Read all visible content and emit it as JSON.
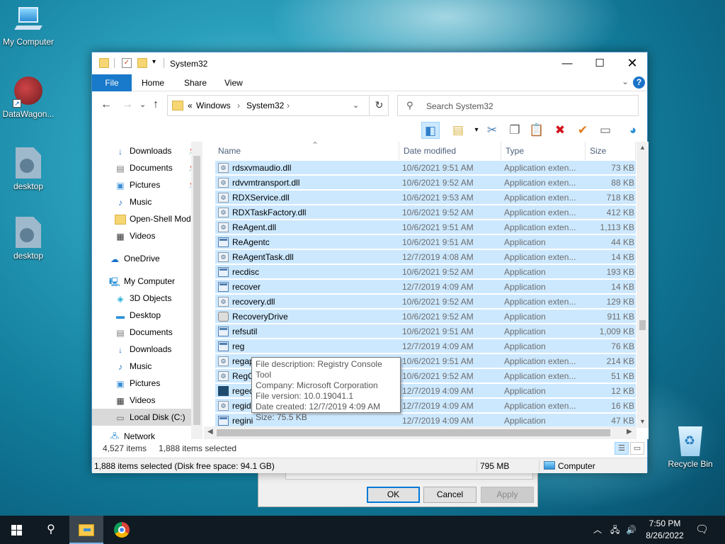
{
  "desktop": {
    "icons": [
      {
        "label": "My Computer"
      },
      {
        "label": "DataWagon..."
      },
      {
        "label": "desktop"
      },
      {
        "label": "desktop"
      },
      {
        "label": "Recycle Bin"
      }
    ]
  },
  "bg_dialog": {
    "ok": "OK",
    "cancel": "Cancel",
    "apply": "Apply"
  },
  "window": {
    "title": "System32",
    "ribbon_tabs": [
      "File",
      "Home",
      "Share",
      "View"
    ],
    "help": "?",
    "address": {
      "overflow": "«",
      "crumbs": [
        "Windows",
        "System32"
      ]
    },
    "search_placeholder": "Search System32",
    "nav": {
      "quick": [
        "Downloads",
        "Documents",
        "Pictures",
        "Music",
        "Open-Shell Mod",
        "Videos"
      ],
      "onedrive": "OneDrive",
      "mycomputer": "My Computer",
      "pc_items": [
        "3D Objects",
        "Desktop",
        "Documents",
        "Downloads",
        "Music",
        "Pictures",
        "Videos",
        "Local Disk (C:)"
      ],
      "network": "Network"
    },
    "columns": {
      "name": "Name",
      "date": "Date modified",
      "type": "Type",
      "size": "Size"
    },
    "files": [
      {
        "name": "rdsxvmaudio.dll",
        "date": "10/6/2021 9:51 AM",
        "type": "Application exten...",
        "size": "73 KB",
        "icon": "dll"
      },
      {
        "name": "rdvvmtransport.dll",
        "date": "10/6/2021 9:52 AM",
        "type": "Application exten...",
        "size": "88 KB",
        "icon": "dll"
      },
      {
        "name": "RDXService.dll",
        "date": "10/6/2021 9:53 AM",
        "type": "Application exten...",
        "size": "718 KB",
        "icon": "dll"
      },
      {
        "name": "RDXTaskFactory.dll",
        "date": "10/6/2021 9:52 AM",
        "type": "Application exten...",
        "size": "412 KB",
        "icon": "dll"
      },
      {
        "name": "ReAgent.dll",
        "date": "10/6/2021 9:51 AM",
        "type": "Application exten...",
        "size": "1,113 KB",
        "icon": "dll"
      },
      {
        "name": "ReAgentc",
        "date": "10/6/2021 9:51 AM",
        "type": "Application",
        "size": "44 KB",
        "icon": "exe"
      },
      {
        "name": "ReAgentTask.dll",
        "date": "12/7/2019 4:08 AM",
        "type": "Application exten...",
        "size": "14 KB",
        "icon": "dll"
      },
      {
        "name": "recdisc",
        "date": "10/6/2021 9:52 AM",
        "type": "Application",
        "size": "193 KB",
        "icon": "exe"
      },
      {
        "name": "recover",
        "date": "12/7/2019 4:09 AM",
        "type": "Application",
        "size": "14 KB",
        "icon": "exe"
      },
      {
        "name": "recovery.dll",
        "date": "10/6/2021 9:52 AM",
        "type": "Application exten...",
        "size": "129 KB",
        "icon": "dll"
      },
      {
        "name": "RecoveryDrive",
        "date": "10/6/2021 9:52 AM",
        "type": "Application",
        "size": "911 KB",
        "icon": "drive"
      },
      {
        "name": "refsutil",
        "date": "10/6/2021 9:51 AM",
        "type": "Application",
        "size": "1,009 KB",
        "icon": "exe"
      },
      {
        "name": "reg",
        "date": "12/7/2019 4:09 AM",
        "type": "Application",
        "size": "76 KB",
        "icon": "exe"
      },
      {
        "name": "regapi.dll",
        "date": "10/6/2021 9:51 AM",
        "type": "Application exten...",
        "size": "214 KB",
        "icon": "dll"
      },
      {
        "name": "RegCtrl.dll",
        "date": "10/6/2021 9:52 AM",
        "type": "Application exten...",
        "size": "51 KB",
        "icon": "dll"
      },
      {
        "name": "regedt32",
        "date": "12/7/2019 4:09 AM",
        "type": "Application",
        "size": "12 KB",
        "icon": "img"
      },
      {
        "name": "regidle.dll",
        "date": "12/7/2019 4:09 AM",
        "type": "Application exten...",
        "size": "16 KB",
        "icon": "dll"
      },
      {
        "name": "regini",
        "date": "12/7/2019 4:09 AM",
        "type": "Application",
        "size": "47 KB",
        "icon": "exe"
      }
    ],
    "tooltip": {
      "l1": "File description: Registry Console Tool",
      "l2": "Company: Microsoft Corporation",
      "l3": "File version: 10.0.19041.1",
      "l4": "Date created: 12/7/2019 4:09 AM",
      "l5": "Size: 75.5 KB"
    },
    "status": {
      "items": "4,527 items",
      "selected": "1,888 items selected",
      "bottom_left": "1,888 items selected (Disk free space: 94.1 GB)",
      "bottom_size": "795 MB",
      "bottom_loc": "Computer"
    }
  },
  "taskbar": {
    "time": "7:50 PM",
    "date": "8/26/2022"
  }
}
